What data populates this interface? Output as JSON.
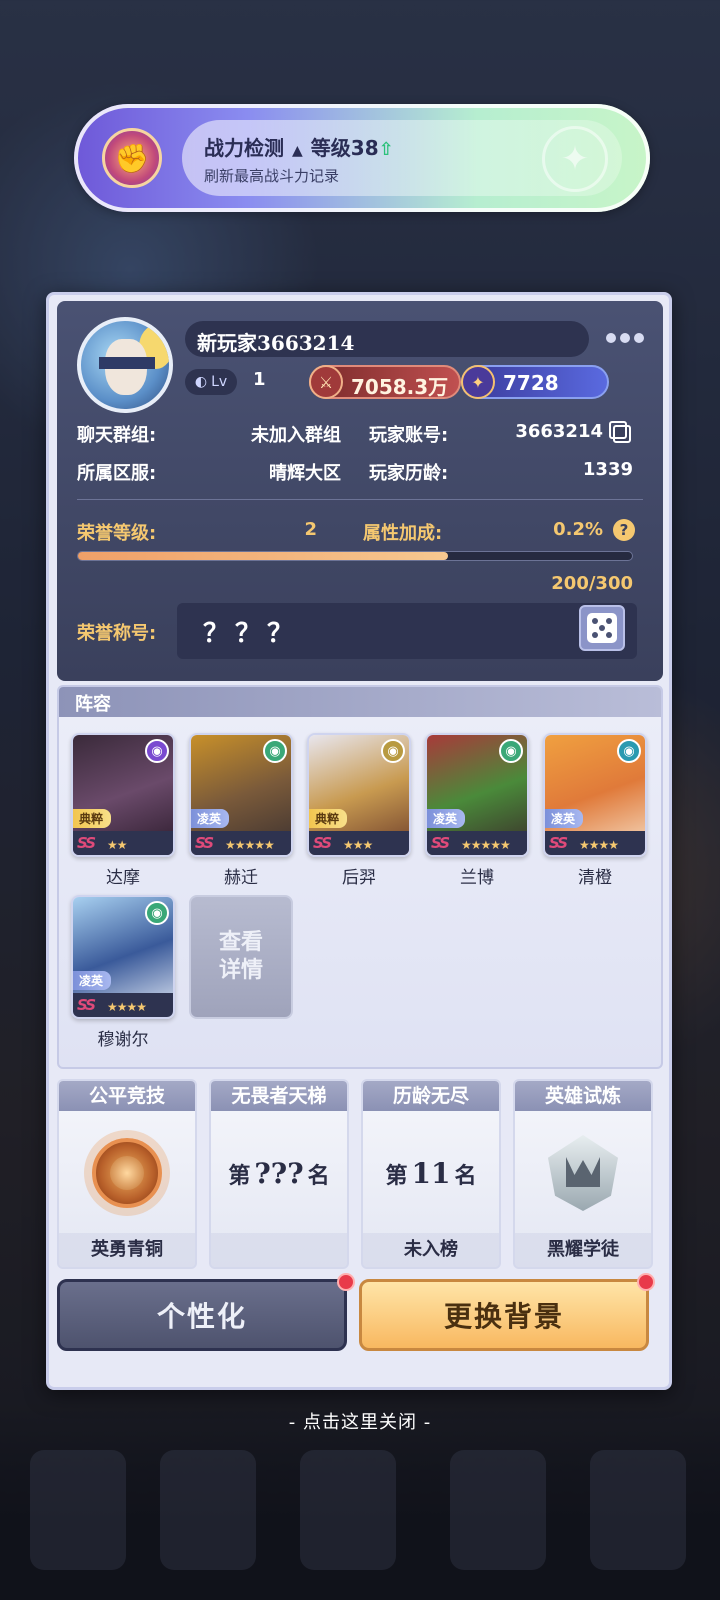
{
  "toast": {
    "title": "战力检测",
    "level_label": "等级38",
    "subtitle": "刷新最高战斗力记录"
  },
  "profile": {
    "name": "新玩家3663214",
    "level_badge": "Lv",
    "level": "1",
    "power": "7058.3万",
    "gems": "7728",
    "chat_group_label": "聊天群组:",
    "chat_group_value": "未加入群组",
    "account_label": "玩家账号:",
    "account_value": "3663214",
    "server_label": "所属区服:",
    "server_value": "晴辉大区",
    "age_label": "玩家历龄:",
    "age_value": "1339",
    "honor_level_label": "荣誉等级:",
    "honor_level_value": "2",
    "bonus_label": "属性加成:",
    "bonus_value": "0.2%",
    "honor_progress_text": "200/300",
    "honor_progress_fraction": 0.667,
    "honor_title_label": "荣誉称号:",
    "honor_title_value": "？？？"
  },
  "lineup": {
    "title": "阵容",
    "heroes": [
      {
        "name": "达摩",
        "tag": "典粹",
        "rarity": "SS",
        "stars": "★★",
        "element_color": "#7a4ad0",
        "tag_style": "gold"
      },
      {
        "name": "赫迁",
        "tag": "凌英",
        "rarity": "SS",
        "stars": "★★★★★",
        "element_color": "#3aa878",
        "tag_style": "blue"
      },
      {
        "name": "后羿",
        "tag": "典粹",
        "rarity": "SS",
        "stars": "★★★",
        "element_color": "#b89a40",
        "tag_style": "gold"
      },
      {
        "name": "兰博",
        "tag": "凌英",
        "rarity": "SS",
        "stars": "★★★★★",
        "element_color": "#3aa878",
        "tag_style": "blue"
      },
      {
        "name": "清橙",
        "tag": "凌英",
        "rarity": "SS",
        "stars": "★★★★",
        "element_color": "#2a9ab0",
        "tag_style": "blue"
      },
      {
        "name": "穆谢尔",
        "tag": "凌英",
        "rarity": "SS",
        "stars": "★★★★",
        "element_color": "#3aa878",
        "tag_style": "blue"
      }
    ],
    "detail_button": "查看详情"
  },
  "ranks": [
    {
      "title": "公平竞技",
      "footer": "英勇青铜"
    },
    {
      "title": "无畏者天梯",
      "prefix": "第",
      "value": "???",
      "suffix": "名",
      "footer": ""
    },
    {
      "title": "历龄无尽",
      "prefix": "第",
      "value": "11",
      "suffix": "名",
      "footer": "未入榜"
    },
    {
      "title": "英雄试炼",
      "footer": "黑耀学徒"
    }
  ],
  "buttons": {
    "personalize": "个性化",
    "change_background": "更换背景"
  },
  "close_hint": "- 点击这里关闭 -"
}
